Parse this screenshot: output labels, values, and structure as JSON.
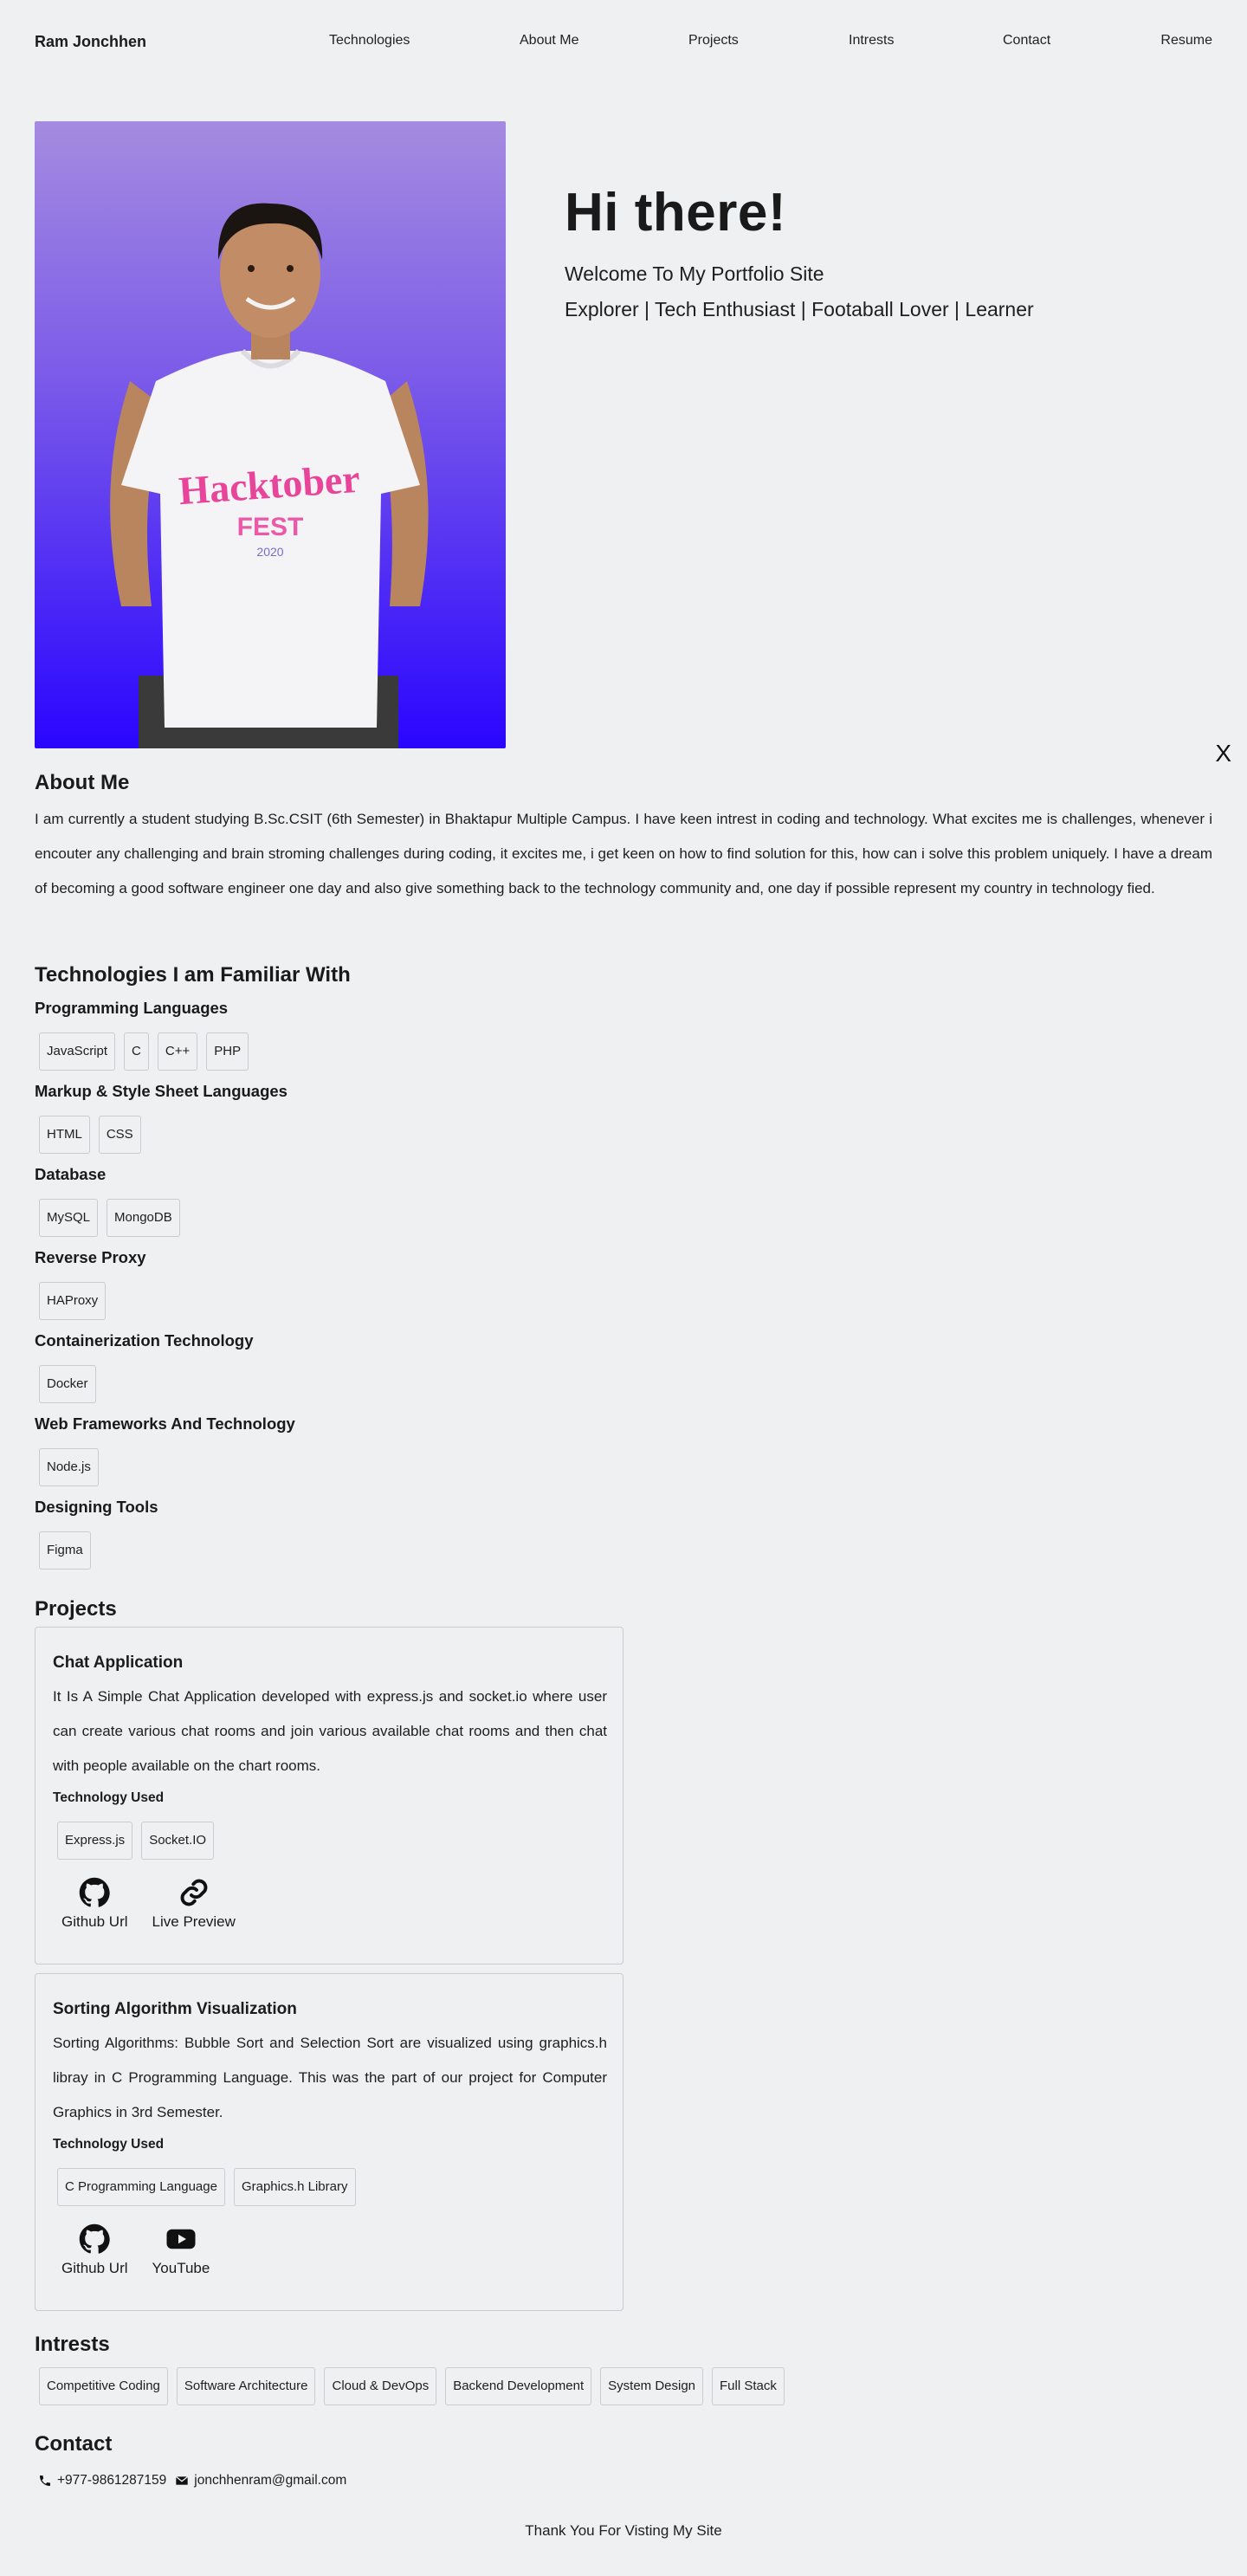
{
  "nav": {
    "brand": "Ram Jonchhen",
    "links": [
      "Technologies",
      "About Me",
      "Projects",
      "Intrests",
      "Contact",
      "Resume"
    ]
  },
  "hero": {
    "title": "Hi there!",
    "subtitle": "Welcome To My Portfolio Site",
    "tagline": "Explorer | Tech Enthusiast | Footaball Lover | Learner",
    "photo_shirt_text": "Hacktober FEST 2020",
    "close_label": "X"
  },
  "about": {
    "title": "About Me",
    "text": "I am currently a student studying B.Sc.CSIT (6th Semester) in Bhaktapur Multiple Campus. I have keen intrest in coding and technology. What excites me is challenges, whenever i encouter any challenging and brain stroming challenges during coding, it excites me, i get keen on how to find solution for this, how can i solve this problem uniquely. I have a dream of becoming a good software engineer one day and also give something back to the technology community and, one day if possible represent my country in technology fied."
  },
  "technologies": {
    "title": "Technologies I am Familiar With",
    "groups": [
      {
        "name": "Programming Languages",
        "items": [
          "JavaScript",
          "C",
          "C++",
          "PHP"
        ]
      },
      {
        "name": "Markup & Style Sheet Languages",
        "items": [
          "HTML",
          "CSS"
        ]
      },
      {
        "name": "Database",
        "items": [
          "MySQL",
          "MongoDB"
        ]
      },
      {
        "name": "Reverse Proxy",
        "items": [
          "HAProxy"
        ]
      },
      {
        "name": "Containerization Technology",
        "items": [
          "Docker"
        ]
      },
      {
        "name": "Web Frameworks And Technology",
        "items": [
          "Node.js"
        ]
      },
      {
        "name": "Designing Tools",
        "items": [
          "Figma"
        ]
      }
    ]
  },
  "projects": {
    "title": "Projects",
    "items": [
      {
        "title": "Chat Application",
        "description": "It Is A Simple Chat Application developed with express.js and socket.io where user can create various chat rooms and join various available chat rooms and then chat with people available on the chart rooms.",
        "tech_label": "Technology Used",
        "tech": [
          "Express.js",
          "Socket.IO"
        ],
        "links": [
          {
            "label": "Github Url",
            "icon": "github-icon"
          },
          {
            "label": "Live Preview",
            "icon": "link-icon"
          }
        ]
      },
      {
        "title": "Sorting Algorithm Visualization",
        "description": "Sorting Algorithms: Bubble Sort and Selection Sort are visualized using graphics.h libray in C Programming Language. This was the part of our project for Computer Graphics in 3rd Semester.",
        "tech_label": "Technology Used",
        "tech": [
          "C Programming Language",
          "Graphics.h Library"
        ],
        "links": [
          {
            "label": "Github Url",
            "icon": "github-icon"
          },
          {
            "label": "YouTube",
            "icon": "youtube-icon"
          }
        ]
      }
    ]
  },
  "interests": {
    "title": "Intrests",
    "items": [
      "Competitive Coding",
      "Software Architecture",
      "Cloud & DevOps",
      "Backend Development",
      "System Design",
      "Full Stack"
    ]
  },
  "contact": {
    "title": "Contact",
    "phone": "+977-9861287159",
    "email": "jonchhenram@gmail.com"
  },
  "footer": {
    "text": "Thank You For Visting My Site"
  }
}
